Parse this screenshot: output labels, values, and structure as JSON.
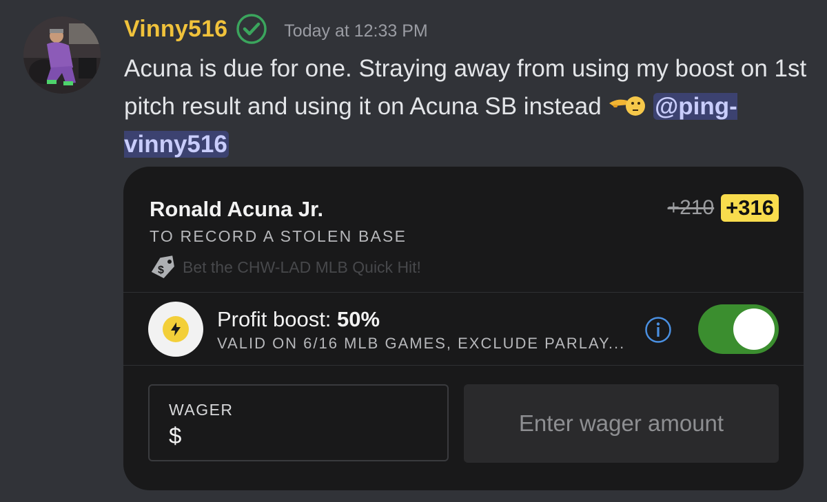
{
  "message": {
    "username": "Vinny516",
    "timestamp": "Today at 12:33 PM",
    "text": "Acuna is due for one. Straying away from using my boost on 1st pitch result and using it on Acuna SB instead",
    "emoji": "pointing-hand-emoji",
    "mention": "@ping-vinny516",
    "colors": {
      "username": "#f0c23b",
      "verified": "#3ba55d",
      "mention_bg": "#3c4270"
    }
  },
  "bet_card": {
    "player": "Ronald Acuna Jr.",
    "market": "TO RECORD A STOLEN BASE",
    "promo_text": "Bet the CHW-LAD MLB Quick Hit!",
    "odds_original": "+210",
    "odds_boosted": "+316",
    "boost": {
      "label": "Profit boost: ",
      "value": "50%",
      "description": "VALID ON 6/16 MLB GAMES, EXCLUDE PARLAY...",
      "enabled": true
    },
    "wager": {
      "label": "WAGER",
      "currency": "$",
      "placeholder": "Enter wager amount",
      "value": ""
    },
    "colors": {
      "odds_highlight": "#f8dc4d",
      "toggle_on": "#3b8e2f",
      "info": "#4a90e2"
    }
  }
}
